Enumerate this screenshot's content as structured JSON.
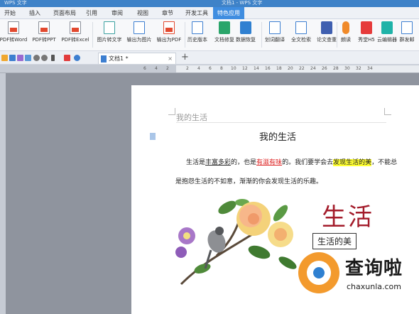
{
  "window": {
    "app_name": "WPS 文字",
    "doc_title": "文档1 - WPS 文字"
  },
  "tabs": [
    {
      "label": "开始",
      "active": false
    },
    {
      "label": "插入",
      "active": false
    },
    {
      "label": "页面布局",
      "active": false
    },
    {
      "label": "引用",
      "active": false
    },
    {
      "label": "审阅",
      "active": false
    },
    {
      "label": "视图",
      "active": false
    },
    {
      "label": "章节",
      "active": false
    },
    {
      "label": "开发工具",
      "active": false
    },
    {
      "label": "特色应用",
      "active": true
    }
  ],
  "ribbon": [
    {
      "label": "PDF转Word",
      "icon": "pdf-to-word-icon"
    },
    {
      "label": "PDF转PPT",
      "icon": "pdf-to-ppt-icon"
    },
    {
      "label": "PDF转Excel",
      "icon": "pdf-to-excel-icon"
    },
    {
      "label": "图片转文字",
      "icon": "image-to-text-icon"
    },
    {
      "label": "输出为图片",
      "icon": "export-image-icon"
    },
    {
      "label": "输出为PDF",
      "icon": "export-pdf-icon"
    },
    {
      "label": "历史版本",
      "icon": "history-icon"
    },
    {
      "label": "文档修复",
      "icon": "repair-icon"
    },
    {
      "label": "数据恢复",
      "icon": "data-recovery-icon"
    },
    {
      "label": "划词翻译",
      "icon": "translate-icon"
    },
    {
      "label": "全文检索",
      "icon": "search-icon"
    },
    {
      "label": "论文查重",
      "icon": "plagiarism-icon"
    },
    {
      "label": "朗读",
      "icon": "read-aloud-icon"
    },
    {
      "label": "秀堂H5",
      "icon": "xiutang-icon"
    },
    {
      "label": "云编辑器",
      "icon": "cloud-editor-icon"
    },
    {
      "label": "群发邮",
      "icon": "mass-mail-icon"
    }
  ],
  "document_tab": {
    "label": "文档1 *"
  },
  "ruler_numbers": [
    "6",
    "4",
    "2",
    "2",
    "4",
    "6",
    "8",
    "10",
    "12",
    "14",
    "16",
    "18",
    "20",
    "22",
    "24",
    "26",
    "28",
    "30",
    "32",
    "34"
  ],
  "document": {
    "header": "我的生活",
    "title": "我的生活",
    "line1": {
      "a": "生活是",
      "b": "丰富多彩",
      "c": "的，也是",
      "d": "有滋有味",
      "e": "的。我们要学会去",
      "f": "发现生活的美",
      "g": "，不能总"
    },
    "line2": "是抱怨生活的不如意，渐渐的你会发现生活的乐趣。",
    "big_word": "生活",
    "textbox": "生活的美"
  },
  "watermark": {
    "name": "查询啦",
    "url": "chaxunla.com"
  },
  "colors": {
    "accent": "#3f8de0",
    "title_red": "#a31b2a",
    "highlight": "#ffff33"
  }
}
